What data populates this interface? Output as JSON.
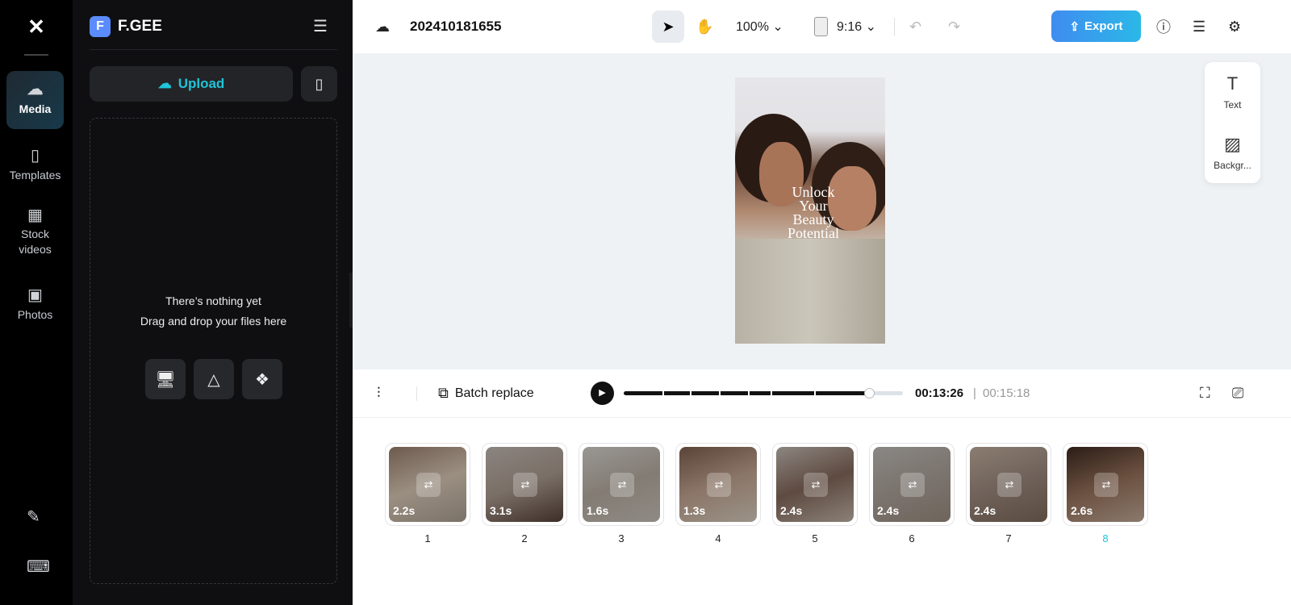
{
  "app": {
    "logo": "CapCut"
  },
  "rail": {
    "items": [
      {
        "label": "Media",
        "icon": "cloud-upload-icon",
        "active": true
      },
      {
        "label": "Templates",
        "icon": "template-icon"
      },
      {
        "label": "Stock videos",
        "icon": "film-icon"
      },
      {
        "label": "Photos",
        "icon": "image-icon"
      }
    ],
    "bottom": [
      {
        "icon": "edit-notes-icon"
      },
      {
        "icon": "keyboard-icon"
      }
    ]
  },
  "panel": {
    "badge": "F",
    "workspace": "F.GEE",
    "upload_label": "Upload",
    "empty_line1": "There’s nothing yet",
    "empty_line2": "Drag and drop your files here",
    "sources": [
      "computer-icon",
      "google-drive-icon",
      "dropbox-icon"
    ]
  },
  "topbar": {
    "project_name": "202410181655",
    "zoom": "100%",
    "ratio": "9:16",
    "export_label": "Export"
  },
  "preview": {
    "text": "Unlock Your Beauty Potential"
  },
  "side_tools": [
    {
      "label": "Text",
      "icon": "text-icon"
    },
    {
      "label": "Backgr...",
      "icon": "background-icon"
    }
  ],
  "playbar": {
    "batch_replace": "Batch replace",
    "current": "00:13:26",
    "separator": "|",
    "total": "00:15:18",
    "progress": 0.88
  },
  "clips": [
    {
      "n": "1",
      "dur": "2.2s"
    },
    {
      "n": "2",
      "dur": "3.1s"
    },
    {
      "n": "3",
      "dur": "1.6s"
    },
    {
      "n": "4",
      "dur": "1.3s"
    },
    {
      "n": "5",
      "dur": "2.4s"
    },
    {
      "n": "6",
      "dur": "2.4s"
    },
    {
      "n": "7",
      "dur": "2.4s"
    },
    {
      "n": "8",
      "dur": "2.6s",
      "selected": true
    }
  ],
  "colors": {
    "accent": "#1fc4d8",
    "export": "#3f8cf0"
  }
}
